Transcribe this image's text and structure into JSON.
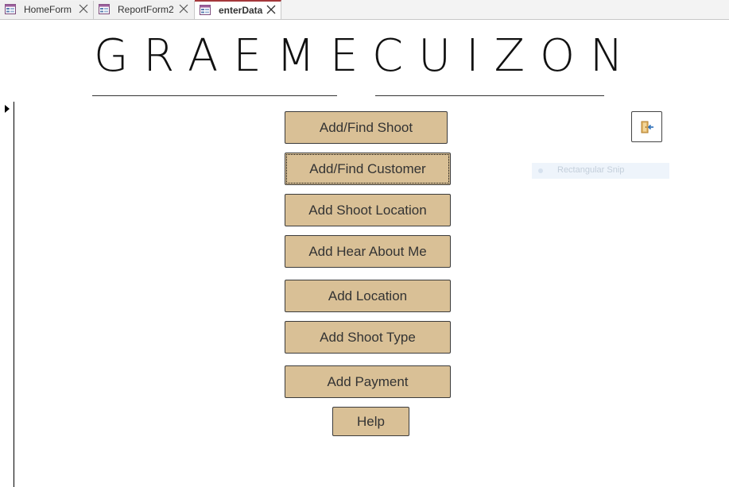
{
  "tabs": [
    {
      "label": "HomeForm",
      "active": false
    },
    {
      "label": "ReportForm2",
      "active": false
    },
    {
      "label": "enterData",
      "active": true
    }
  ],
  "brand": {
    "word1": "GRAEME",
    "word2": "CUIZON"
  },
  "menu": {
    "add_find_shoot": "Add/Find Shoot",
    "add_find_customer": "Add/Find Customer",
    "add_shoot_location": "Add Shoot Location",
    "add_hear_about_me": "Add Hear About Me",
    "add_location": "Add Location",
    "add_shoot_type": "Add Shoot Type",
    "add_payment": "Add Payment",
    "help": "Help"
  },
  "exit_button": {
    "icon": "exit-door-icon"
  },
  "overlay": {
    "snip_label": "Rectangular Snip"
  },
  "colors": {
    "button_fill": "#d9c096",
    "active_tab_accent": "#a4373a"
  }
}
